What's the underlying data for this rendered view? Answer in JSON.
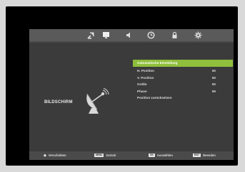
{
  "tabs": [
    {
      "icon": "satellite-icon"
    },
    {
      "icon": "display-icon"
    },
    {
      "icon": "speaker-icon"
    },
    {
      "icon": "clock-icon"
    },
    {
      "icon": "lock-icon"
    },
    {
      "icon": "gear-icon"
    }
  ],
  "panel": {
    "title": "BILDSCHIRM",
    "icon": "satellite-dish-icon"
  },
  "menu": {
    "items": [
      {
        "label": "Automatische Einstellung",
        "value": "",
        "selected": true
      },
      {
        "label": "H. Position",
        "value": "50"
      },
      {
        "label": "V. Position",
        "value": "50"
      },
      {
        "label": "Größe",
        "value": "50"
      },
      {
        "label": "Phase",
        "value": "69"
      },
      {
        "label": "Position zurücksetzen",
        "value": ""
      }
    ]
  },
  "footer": {
    "move": {
      "key": "◆",
      "label": "Verschieben"
    },
    "back": {
      "key": "MENU",
      "label": "Zurück"
    },
    "select": {
      "key": "OK",
      "label": "Auswählen"
    },
    "exit": {
      "key": "EXIT",
      "label": "Beenden"
    }
  },
  "colors": {
    "selected": "#8fbf3c",
    "background": "#3b3b3b",
    "screen": "#000000"
  }
}
